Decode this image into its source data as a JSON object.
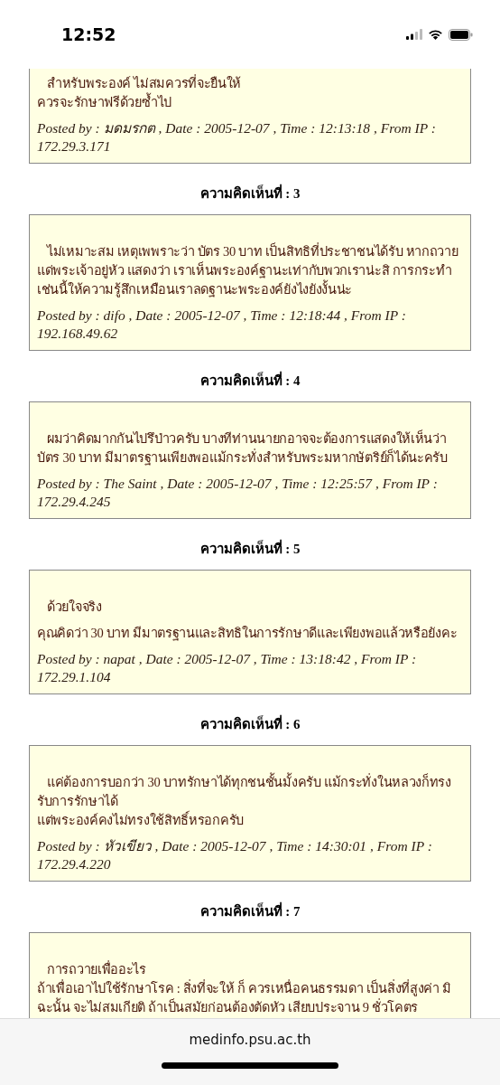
{
  "status_bar": {
    "time": "12:52"
  },
  "comments": [
    {
      "paragraphs": [
        [
          "สำหรับพระองค์ ไม่สมควรที่จะยืนให้",
          "ควรจะรักษาฟรีด้วยซ้ำไป"
        ]
      ],
      "posted": "Posted by : มดมรกต , Date : 2005-12-07 , Time : 12:13:18 , From IP : 172.29.3.171"
    },
    {
      "heading": "ความคิดเห็นที่ : 3",
      "paragraphs": [
        [
          "ไม่เหมาะสม เหตุเพพราะว่า บัตร 30 บาท เป็นสิทธิที่ประชาชนได้รับ หากถวายแด่พระเจ้าอยู่หัว แสดงว่า เราเห็นพระองค์ฐานะเท่ากับพวกเราน่ะสิ การกระทำเช่นนี้ให้ความรู้สึกเหมือนเราลดฐานะพระองค์ยังไงยังงั้นน่ะ"
        ]
      ],
      "posted": "Posted by : difo , Date : 2005-12-07 , Time : 12:18:44 , From IP : 192.168.49.62"
    },
    {
      "heading": "ความคิดเห็นที่ : 4",
      "paragraphs": [
        [
          "ผมว่าคิดมากกันไปรึป่าวครับ บางทีท่านนายกอาจจะต้องการแสดงให้เห็นว่า บัตร 30 บาท มีมาตรฐานเพียงพอแม้กระทั่งสำหรับพระมหากษัตริย์ก็ได้นะครับ"
        ]
      ],
      "posted": "Posted by : The Saint , Date : 2005-12-07 , Time : 12:25:57 , From IP : 172.29.4.245"
    },
    {
      "heading": "ความคิดเห็นที่ : 5",
      "paragraphs": [
        [
          "ด้วยใจจริง"
        ],
        [
          "คุณคิดว่า 30 บาท มีมาตรฐานและสิทธิในการรักษาดีและเพียงพอแล้วหรือยังคะ"
        ]
      ],
      "posted": "Posted by : napat , Date : 2005-12-07 , Time : 13:18:42 , From IP : 172.29.1.104"
    },
    {
      "heading": "ความคิดเห็นที่ : 6",
      "paragraphs": [
        [
          "แค่ต้องการบอกว่า 30 บาทรักษาได้ทุกชนชั้นมั้งครับ แม้กระทั่งในหลวงก็ทรงรับการรักษาได้",
          "แต่พระองค์คงไม่ทรงใช้สิทธิ์หรอกครับ"
        ]
      ],
      "posted": "Posted by : หัวเขียว , Date : 2005-12-07 , Time : 14:30:01 , From IP : 172.29.4.220"
    },
    {
      "heading": "ความคิดเห็นที่ : 7",
      "paragraphs": [
        [
          "การถวายเพื่ออะไร",
          "ถ้าเพื่อเอาไปใช้รักษาโรค : สิ่งที่จะให้ ก็ ควรเหนื่อคนธรรมดา เป็นสิ่งที่สูงค่า มิฉะนั้น จะไม่สมเกียติ ถ้าเป็นสมัยก่อนต้องตัดหัว เสียบประจาน 9 ชั่วโคตร"
        ]
      ]
    }
  ],
  "address_bar": {
    "url": "medinfo.psu.ac.th"
  }
}
